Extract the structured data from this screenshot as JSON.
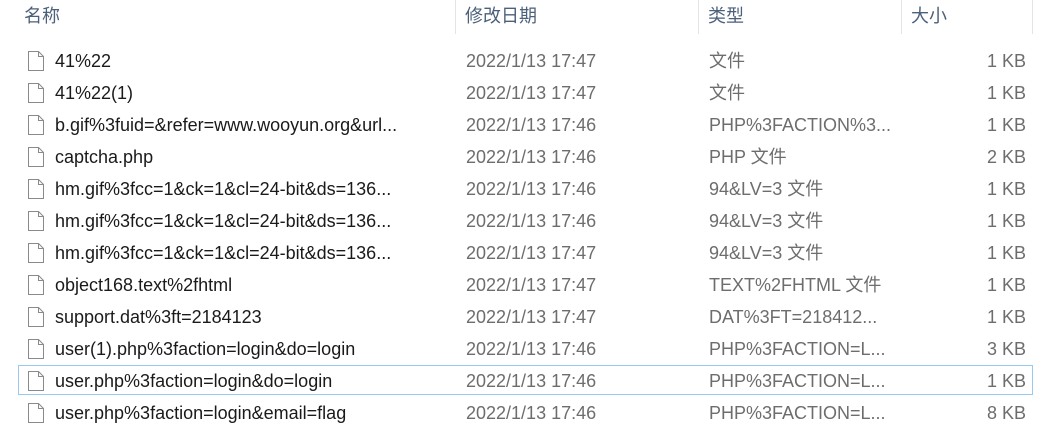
{
  "columns": {
    "name": "名称",
    "date": "修改日期",
    "type": "类型",
    "size": "大小"
  },
  "files": [
    {
      "name": "41%22",
      "date": "2022/1/13 17:47",
      "type": "文件",
      "size": "1 KB"
    },
    {
      "name": "41%22(1)",
      "date": "2022/1/13 17:47",
      "type": "文件",
      "size": "1 KB"
    },
    {
      "name": "b.gif%3fuid=&refer=www.wooyun.org&url...",
      "date": "2022/1/13 17:46",
      "type": "PHP%3FACTION%3...",
      "size": "1 KB"
    },
    {
      "name": "captcha.php",
      "date": "2022/1/13 17:46",
      "type": "PHP 文件",
      "size": "2 KB"
    },
    {
      "name": "hm.gif%3fcc=1&ck=1&cl=24-bit&ds=136...",
      "date": "2022/1/13 17:46",
      "type": "94&LV=3 文件",
      "size": "1 KB"
    },
    {
      "name": "hm.gif%3fcc=1&ck=1&cl=24-bit&ds=136...",
      "date": "2022/1/13 17:46",
      "type": "94&LV=3 文件",
      "size": "1 KB"
    },
    {
      "name": "hm.gif%3fcc=1&ck=1&cl=24-bit&ds=136...",
      "date": "2022/1/13 17:47",
      "type": "94&LV=3 文件",
      "size": "1 KB"
    },
    {
      "name": "object168.text%2fhtml",
      "date": "2022/1/13 17:47",
      "type": "TEXT%2FHTML 文件",
      "size": "1 KB"
    },
    {
      "name": "support.dat%3ft=2184123",
      "date": "2022/1/13 17:47",
      "type": "DAT%3FT=218412...",
      "size": "1 KB"
    },
    {
      "name": "user(1).php%3faction=login&do=login",
      "date": "2022/1/13 17:46",
      "type": "PHP%3FACTION=L...",
      "size": "3 KB"
    },
    {
      "name": "user.php%3faction=login&do=login",
      "date": "2022/1/13 17:46",
      "type": "PHP%3FACTION=L...",
      "size": "1 KB"
    },
    {
      "name": "user.php%3faction=login&email=flag",
      "date": "2022/1/13 17:46",
      "type": "PHP%3FACTION=L...",
      "size": "8 KB"
    }
  ],
  "icon": "file-icon",
  "colors": {
    "header_text": "#4c607a",
    "name_text": "#1a1a1a",
    "meta_text": "#6d6d6d",
    "focus_outline": "#99c9ef"
  }
}
